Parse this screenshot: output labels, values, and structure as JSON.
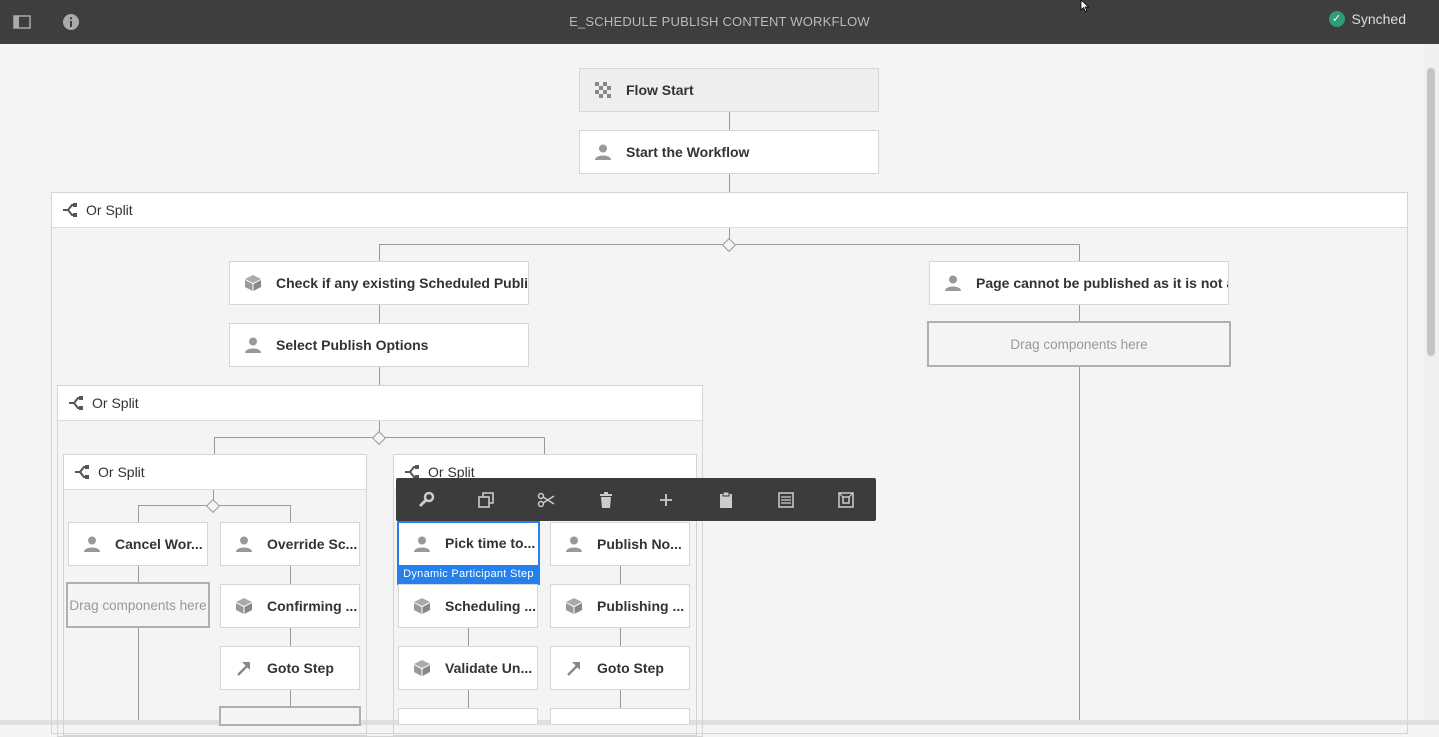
{
  "header": {
    "title": "E_SCHEDULE PUBLISH CONTENT WORKFLOW",
    "status_label": "Synched",
    "left_icons": [
      "sidebar-toggle-icon",
      "info-icon"
    ]
  },
  "colors": {
    "topbar": "#3e3e3e",
    "selection": "#2680eb",
    "synched": "#2d9d78",
    "toolbar": "#3c3c3c"
  },
  "workflow": {
    "flow_start": "Flow Start",
    "start_workflow": "Start the Workflow",
    "split_label": "Or Split",
    "check_existing": "Check if any existing Scheduled Publish",
    "select_options": "Select Publish Options",
    "page_cannot": "Page cannot be published as it is not a...",
    "drop_hint": "Drag components here",
    "cancel_wor": "Cancel Wor...",
    "override_sc": "Override Sc...",
    "confirming": "Confirming ...",
    "goto_step": "Goto Step",
    "pick_time": "Pick time to...",
    "pick_time_tag": "Dynamic Participant Step",
    "publish_no": "Publish No...",
    "scheduling": "Scheduling ...",
    "publishing": "Publishing ...",
    "validate_un": "Validate Un..."
  },
  "toolbar": {
    "actions": [
      "configure",
      "copy",
      "cut",
      "delete",
      "insert",
      "paste",
      "group",
      "parent"
    ]
  }
}
